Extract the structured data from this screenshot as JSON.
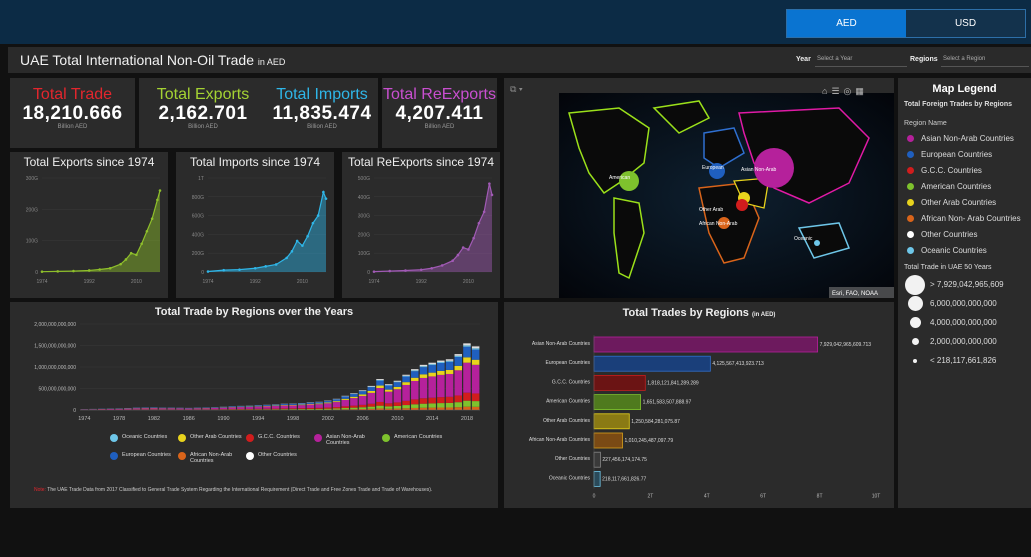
{
  "currency_toggle": {
    "aed": "AED",
    "usd": "USD"
  },
  "header": {
    "title": "UAE Total International Non-Oil Trade",
    "title_suffix": "in AED",
    "year_label": "Year",
    "year_placeholder": "Select a Year",
    "regions_label": "Regions",
    "regions_placeholder": "Select a Region"
  },
  "kpis": [
    {
      "label": "Total Trade",
      "value": "18,210.666",
      "unit": "Billion AED",
      "color": "#e3262d"
    },
    {
      "label": "Total Exports",
      "value": "2,162.701",
      "unit": "Billion AED",
      "color": "#a4d233"
    },
    {
      "label": "Total Imports",
      "value": "11,835.474",
      "unit": "Billion AED",
      "color": "#2fb6e8"
    },
    {
      "label": "Total ReExports",
      "value": "4,207.411",
      "unit": "Billion AED",
      "color": "#c94fd0"
    }
  ],
  "mini_charts": [
    {
      "title": "Total Exports since 1974",
      "color": "#8fc02b",
      "yticks": [
        "0",
        "100G",
        "200G",
        "300G"
      ],
      "xticks": [
        "1974",
        "1992",
        "2010"
      ]
    },
    {
      "title": "Total Imports since 1974",
      "color": "#2fb6e8",
      "yticks": [
        "0",
        "200G",
        "400G",
        "600G",
        "800G",
        "1T"
      ],
      "xticks": [
        "1974",
        "1992",
        "2010"
      ]
    },
    {
      "title": "Total ReExports since 1974",
      "color": "#a15ab5",
      "yticks": [
        "0",
        "100G",
        "200G",
        "300G",
        "400G",
        "500G"
      ],
      "xticks": [
        "1974",
        "1992",
        "2010"
      ]
    }
  ],
  "map": {
    "labels": [
      "American",
      "European",
      "Asian Non-Arab",
      "Other Arab",
      "African Non-Arab",
      "Oceanic"
    ],
    "attribution": "Esri, FAO, NOAA"
  },
  "legend": {
    "title": "Map Legend",
    "subtitle": "Total Foreign Trades by Regions",
    "region_header": "Region Name",
    "regions": [
      {
        "name": "Asian Non-Arab Countries",
        "color": "#b5219b"
      },
      {
        "name": "European Countries",
        "color": "#1f5fbf"
      },
      {
        "name": "G.C.C. Countries",
        "color": "#d11d1d"
      },
      {
        "name": "American Countries",
        "color": "#7ec22d"
      },
      {
        "name": "Other Arab Countries",
        "color": "#e8d31d"
      },
      {
        "name": "African Non- Arab Countries",
        "color": "#d9641a"
      },
      {
        "name": "Other Countries",
        "color": "#ffffff"
      },
      {
        "name": "Oceanic Countries",
        "color": "#6ec6e8"
      }
    ],
    "size_header": "Total Trade in UAE 50 Years",
    "sizes": [
      "> 7,929,042,965,609",
      "6,000,000,000,000",
      "4,000,000,000,000",
      "2,000,000,000,000",
      "< 218,117,661,826"
    ]
  },
  "stacked": {
    "title": "Total Trade by Regions over the Years",
    "yticks": [
      "0",
      "500,000,000,000",
      "1,000,000,000,000",
      "1,500,000,000,000",
      "2,000,000,000,000"
    ],
    "xticks": [
      "1974",
      "1978",
      "1982",
      "1986",
      "1990",
      "1994",
      "1998",
      "2002",
      "2006",
      "2010",
      "2014",
      "2018"
    ],
    "legend": [
      {
        "name": "Oceanic Countries",
        "color": "#6ec6e8"
      },
      {
        "name": "Other Arab Countries",
        "color": "#e8d31d"
      },
      {
        "name": "G.C.C. Countries",
        "color": "#d11d1d"
      },
      {
        "name": "Asian Non-Arab Countries",
        "color": "#b5219b"
      },
      {
        "name": "American Countries",
        "color": "#7ec22d"
      },
      {
        "name": "European Countries",
        "color": "#1f5fbf"
      },
      {
        "name": "African Non-Arab Countries",
        "color": "#d9641a"
      },
      {
        "name": "Other Countries",
        "color": "#ffffff"
      }
    ],
    "note_label": "Note:",
    "note": "The UAE Trade Data from 2017 Classified to General Trade System Regarding the International Requirement (Direct Trade and Free Zones Trade and Trade of Warehouses)."
  },
  "bars": {
    "title": "Total Trades by Regions",
    "title_suffix": "(in AED)",
    "xticks": [
      "0",
      "2T",
      "4T",
      "6T",
      "8T",
      "10T"
    ]
  },
  "chart_data": [
    {
      "type": "bar",
      "orientation": "horizontal",
      "title": "Total Trades by Regions (in AED)",
      "categories": [
        "Asian Non-Arab Countries",
        "European Countries",
        "G.C.C. Countries",
        "American Countries",
        "Other Arab Countries",
        "African Non-Arab Countries",
        "Other Countries",
        "Oceanic Countries"
      ],
      "values": [
        7929042965609.713,
        4125567413923.713,
        1818121841289.289,
        1651583507888.97,
        1250584281075.87,
        1010245487097.79,
        227456174174.75,
        218117661826.77
      ],
      "labels": [
        "7,929,042,965,609.713",
        "4,125,567,413,923.713",
        "1,818,121,841,289.289",
        "1,651,583,507,888.97",
        "1,250,584,281,075.87",
        "1,010,245,487,097.79",
        "227,456,174,174.75",
        "218,117,661,826.77"
      ],
      "colors": [
        "#6d1a5e",
        "#1a3f7a",
        "#6b1414",
        "#4f7a1e",
        "#8a7a14",
        "#7a4a14",
        "#3a3a3a",
        "#2a4a5a"
      ],
      "edge_colors": [
        "#b5219b",
        "#2f6fd0",
        "#c51d1d",
        "#7ec22d",
        "#e8d31d",
        "#d9a01a",
        "#888888",
        "#6ec6e8"
      ],
      "xlim": [
        0,
        10000000000000
      ]
    },
    {
      "type": "area",
      "title": "Total Exports since 1974",
      "x": [
        1974,
        1980,
        1986,
        1992,
        1996,
        2000,
        2004,
        2006,
        2008,
        2010,
        2012,
        2014,
        2016,
        2018,
        2019
      ],
      "values": [
        1,
        2,
        3,
        5,
        8,
        12,
        25,
        40,
        60,
        55,
        90,
        130,
        170,
        230,
        260
      ],
      "ylim": [
        0,
        300
      ]
    },
    {
      "type": "area",
      "title": "Total Imports since 1974",
      "x": [
        1974,
        1980,
        1986,
        1992,
        1996,
        2000,
        2004,
        2006,
        2008,
        2010,
        2012,
        2014,
        2016,
        2018,
        2019
      ],
      "values": [
        5,
        20,
        25,
        40,
        60,
        80,
        150,
        220,
        330,
        280,
        380,
        520,
        600,
        850,
        780
      ],
      "ylim": [
        0,
        1000
      ]
    },
    {
      "type": "area",
      "title": "Total ReExports since 1974",
      "x": [
        1974,
        1980,
        1986,
        1992,
        1996,
        2000,
        2004,
        2006,
        2008,
        2010,
        2012,
        2014,
        2016,
        2018,
        2019
      ],
      "values": [
        2,
        5,
        8,
        12,
        20,
        35,
        60,
        90,
        130,
        120,
        180,
        260,
        320,
        470,
        410
      ],
      "ylim": [
        0,
        500
      ]
    },
    {
      "type": "bar",
      "stacked": true,
      "title": "Total Trade by Regions over the Years",
      "x": [
        1974,
        1975,
        1976,
        1977,
        1978,
        1979,
        1980,
        1981,
        1982,
        1983,
        1984,
        1985,
        1986,
        1987,
        1988,
        1989,
        1990,
        1991,
        1992,
        1993,
        1994,
        1995,
        1996,
        1997,
        1998,
        1999,
        2000,
        2001,
        2002,
        2003,
        2004,
        2005,
        2006,
        2007,
        2008,
        2009,
        2010,
        2011,
        2012,
        2013,
        2014,
        2015,
        2016,
        2017,
        2018,
        2019
      ],
      "totals": [
        20,
        25,
        30,
        35,
        38,
        45,
        55,
        58,
        60,
        55,
        55,
        52,
        48,
        55,
        58,
        65,
        75,
        85,
        95,
        100,
        110,
        120,
        130,
        145,
        150,
        160,
        180,
        190,
        220,
        260,
        330,
        390,
        460,
        560,
        720,
        600,
        680,
        820,
        950,
        1050,
        1100,
        1150,
        1180,
        1300,
        1550,
        1480
      ],
      "units": "billion AED",
      "ylim": [
        0,
        2000000000000
      ]
    }
  ]
}
